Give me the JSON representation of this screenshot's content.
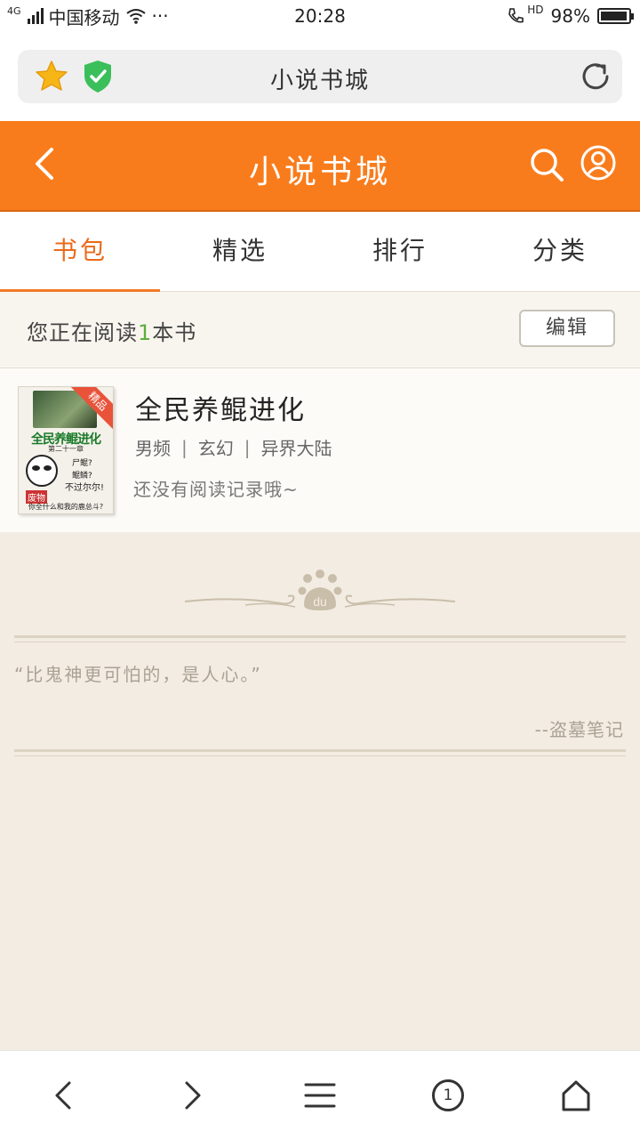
{
  "status_bar": {
    "network": "4G",
    "carrier": "中国移动",
    "dots": "···",
    "time": "20:28",
    "hd_label": "HD",
    "battery": "98%",
    "battery_level": 0.98
  },
  "browser": {
    "title": "小说书城"
  },
  "header": {
    "title": "小说书城"
  },
  "tabs": [
    {
      "label": "书包",
      "active": true
    },
    {
      "label": "精选",
      "active": false
    },
    {
      "label": "排行",
      "active": false
    },
    {
      "label": "分类",
      "active": false
    }
  ],
  "shelf": {
    "reading_prefix": "您正在阅读",
    "reading_count": "1",
    "reading_suffix": "本书",
    "edit_label": "编辑"
  },
  "book": {
    "title": "全民养鲲进化",
    "gender_channel": "男频",
    "genre": "玄幻",
    "sub_genre": "异界大陆",
    "progress": "还没有阅读记录哦~",
    "cover": {
      "badge": "精品",
      "title": "全民养鲲进化",
      "subtitle": "第二十一章",
      "line1": "尸鲲?",
      "line2": "鲲鳞?",
      "line3": "不过尔尔!",
      "line4": "废物",
      "line5": "你全什么和我的鹿总斗?"
    }
  },
  "footer_quote": {
    "text": "“比鬼神更可怕的，是人心。”",
    "source": "--盗墓笔记"
  },
  "bottom_nav": {
    "tab_count": "1"
  },
  "colors": {
    "accent": "#f97c1c",
    "active_tab": "#ea6a1a",
    "count_green": "#5eae3b",
    "background": "#f3ece3"
  }
}
